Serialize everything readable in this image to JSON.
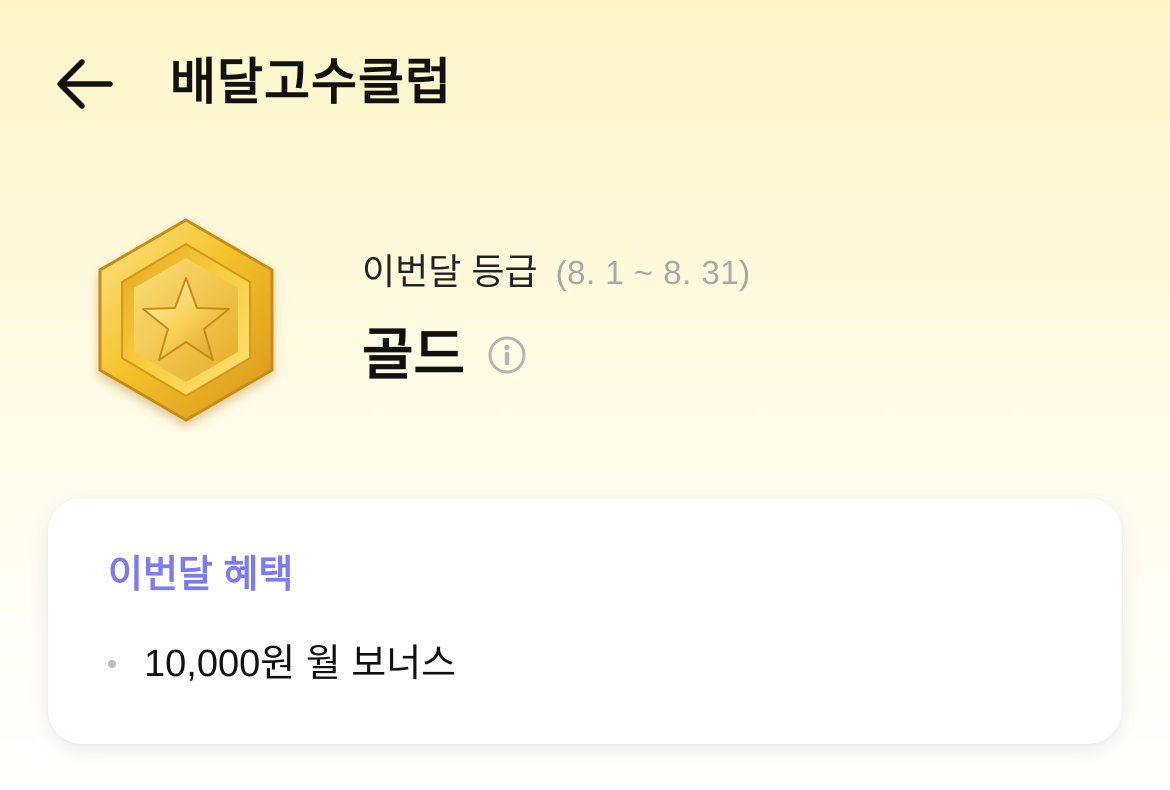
{
  "header": {
    "title": "배달고수클럽",
    "back_icon": "arrow-left-icon"
  },
  "grade": {
    "label": "이번달 등급",
    "period": "(8. 1 ~ 8. 31)",
    "name": "골드",
    "badge_icon": "gold-star-medal",
    "info_icon": "info-icon"
  },
  "benefits": {
    "title": "이번달 혜택",
    "items": [
      {
        "text": "10,000원 월 보너스"
      }
    ]
  },
  "colors": {
    "accent": "#7b7bf2",
    "gold": "#f2c12e",
    "background_top": "#fff6c8"
  }
}
